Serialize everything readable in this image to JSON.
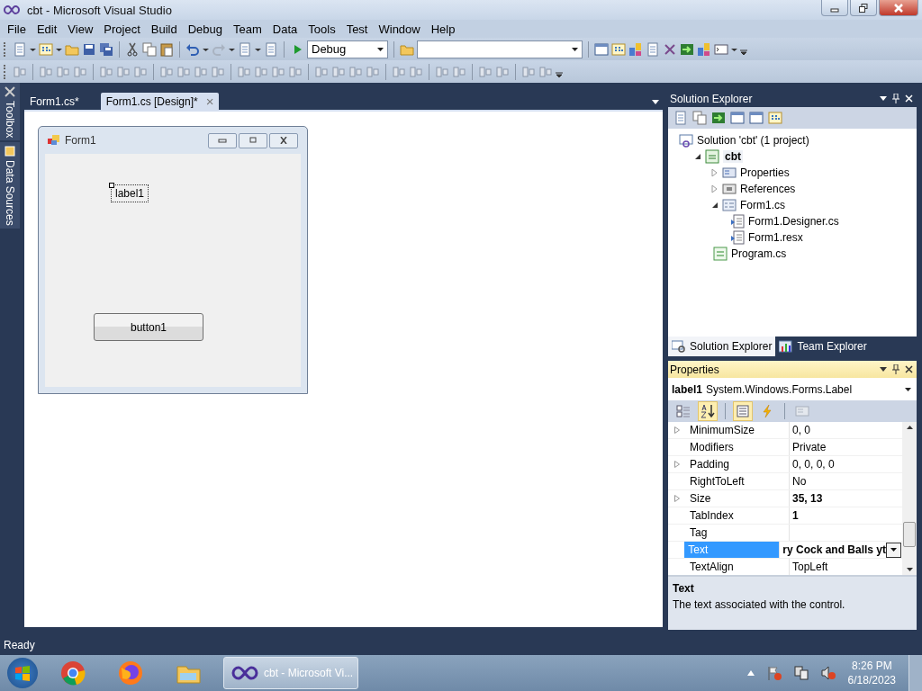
{
  "window": {
    "title": "cbt - Microsoft Visual Studio"
  },
  "menu": [
    "File",
    "Edit",
    "View",
    "Project",
    "Build",
    "Debug",
    "Team",
    "Data",
    "Tools",
    "Test",
    "Window",
    "Help"
  ],
  "toolbar": {
    "configuration": "Debug"
  },
  "side_tabs": [
    "Toolbox",
    "Data Sources"
  ],
  "document_tabs": [
    {
      "label": "Form1.cs*",
      "selected": false
    },
    {
      "label": "Form1.cs [Design]*",
      "selected": true,
      "close": "×"
    }
  ],
  "designer": {
    "form_title": "Form1",
    "controls": [
      {
        "kind": "label",
        "text": "label1",
        "selected": true
      },
      {
        "kind": "button",
        "text": "button1",
        "selected": false
      }
    ]
  },
  "solution_explorer": {
    "title": "Solution Explorer",
    "tree": [
      {
        "label": "Solution 'cbt' (1 project)",
        "kind": "solution",
        "bold": false,
        "children": [
          {
            "label": "cbt",
            "kind": "project",
            "bold": true,
            "expanded": true,
            "children": [
              {
                "label": "Properties",
                "kind": "properties",
                "bold": false,
                "expanded": false
              },
              {
                "label": "References",
                "kind": "references",
                "bold": false,
                "expanded": false
              },
              {
                "label": "Form1.cs",
                "kind": "form",
                "bold": false,
                "expanded": true,
                "children": [
                  {
                    "label": "Form1.Designer.cs",
                    "kind": "linked-file",
                    "bold": false
                  },
                  {
                    "label": "Form1.resx",
                    "kind": "linked-file",
                    "bold": false
                  }
                ]
              },
              {
                "label": "Program.cs",
                "kind": "code-file",
                "bold": false
              }
            ]
          }
        ]
      }
    ],
    "bottom_tabs": [
      {
        "label": "Solution Explorer",
        "kind": "solution",
        "selected": true
      },
      {
        "label": "Team Explorer",
        "kind": "team",
        "selected": false
      }
    ]
  },
  "properties": {
    "title": "Properties",
    "object_name": "label1",
    "object_type": "System.Windows.Forms.Label",
    "toolbar": [
      {
        "kind": "categorized",
        "selected": false
      },
      {
        "kind": "alphabetical",
        "selected": true
      },
      {
        "kind": "properties",
        "selected": true
      },
      {
        "kind": "events",
        "selected": false
      },
      {
        "kind": "pages",
        "selected": false
      }
    ],
    "rows": [
      {
        "name": "MinimumSize",
        "value": "0, 0",
        "expandable": true,
        "modified": false,
        "selected": false
      },
      {
        "name": "Modifiers",
        "value": "Private",
        "expandable": false,
        "modified": false,
        "selected": false
      },
      {
        "name": "Padding",
        "value": "0, 0, 0, 0",
        "expandable": true,
        "modified": false,
        "selected": false
      },
      {
        "name": "RightToLeft",
        "value": "No",
        "expandable": false,
        "modified": false,
        "selected": false
      },
      {
        "name": "Size",
        "value": "35, 13",
        "expandable": true,
        "modified": true,
        "selected": false
      },
      {
        "name": "TabIndex",
        "value": "1",
        "expandable": false,
        "modified": true,
        "selected": false
      },
      {
        "name": "Tag",
        "expandable": false,
        "selected": false
      },
      {
        "name": "Text",
        "value": "ry Cock and Balls yt",
        "expandable": false,
        "modified": true,
        "selected": true
      },
      {
        "name": "TextAlign",
        "value": "TopLeft",
        "expandable": false,
        "modified": false,
        "selected": false
      }
    ],
    "description_title": "Text",
    "description": "The text associated with the control."
  },
  "status_bar": "Ready",
  "taskbar": {
    "task": "cbt - Microsoft Vi...",
    "time": "8:26 PM",
    "date": "6/18/2023"
  }
}
